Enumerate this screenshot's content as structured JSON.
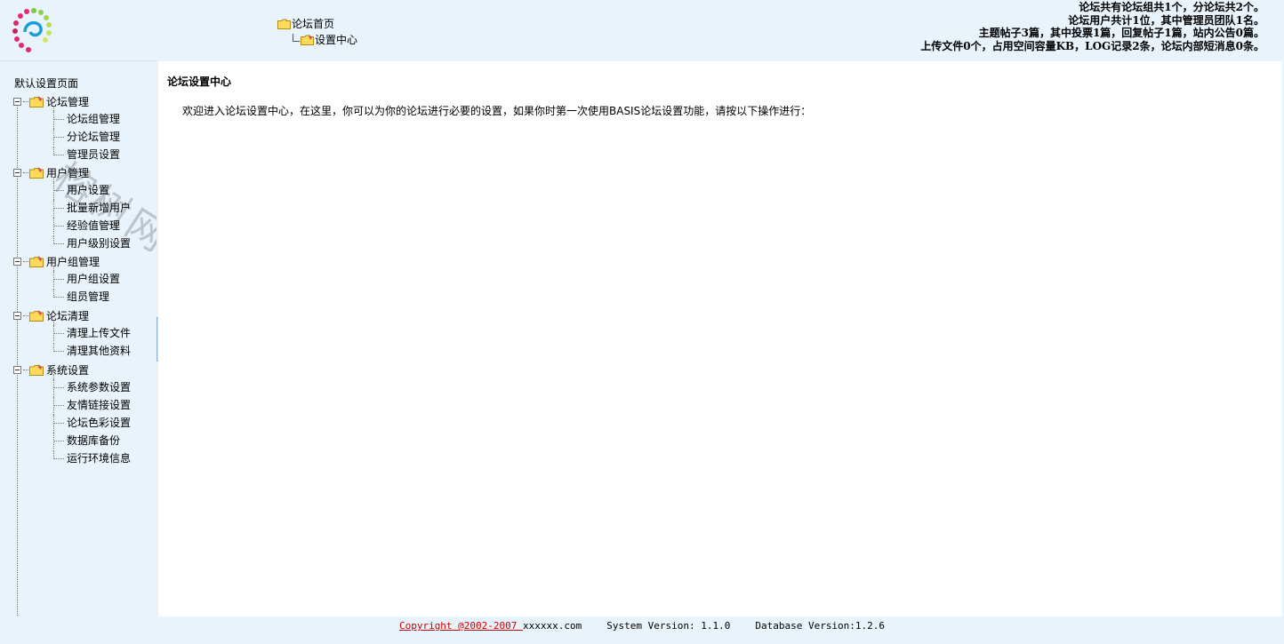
{
  "header": {
    "breadcrumb": [
      "论坛首页",
      "设置中心"
    ],
    "stats": [
      "论坛共有论坛组共1个，分论坛共2个。",
      "论坛用户共计1位，其中管理员团队1名。",
      "主题帖子3篇，其中投票1篇，回复帖子1篇，站内公告0篇。",
      "上传文件0个，占用空间容量KB，LOG记录2条，论坛内部短消息0条。"
    ]
  },
  "sidebar": {
    "default_page": "默认设置页面",
    "watermark": "榕树网络",
    "groups": [
      {
        "label": "论坛管理",
        "items": [
          "论坛组管理",
          "分论坛管理",
          "管理员设置"
        ]
      },
      {
        "label": "用户管理",
        "items": [
          "用户设置",
          "批量新增用户",
          "经验值管理",
          "用户级别设置"
        ]
      },
      {
        "label": "用户组管理",
        "items": [
          "用户组设置",
          "组员管理"
        ]
      },
      {
        "label": "论坛清理",
        "items": [
          "清理上传文件",
          "清理其他资料"
        ]
      },
      {
        "label": "系统设置",
        "items": [
          "系统参数设置",
          "友情链接设置",
          "论坛色彩设置",
          "数据库备份",
          "运行环境信息"
        ]
      }
    ]
  },
  "main": {
    "title": "论坛设置中心",
    "intro": "欢迎进入论坛设置中心，在这里，你可以为你的论坛进行必要的设置，如果你时第一次使用BASIS论坛设置功能，请按以下操作进行："
  },
  "footer": {
    "copyright": "Copyright @2002-2007 ",
    "site": "xxxxxx.com",
    "system_version": "System Version: 1.1.0",
    "database_version": "Database Version:1.2.6"
  },
  "colors": {
    "background": "#e8f3fc",
    "copyright": "#cc0000"
  },
  "icons": {
    "logo": "dotted-ring-logo-icon",
    "folder": "folder-icon",
    "collapse": "collapse-sidebar-icon"
  }
}
